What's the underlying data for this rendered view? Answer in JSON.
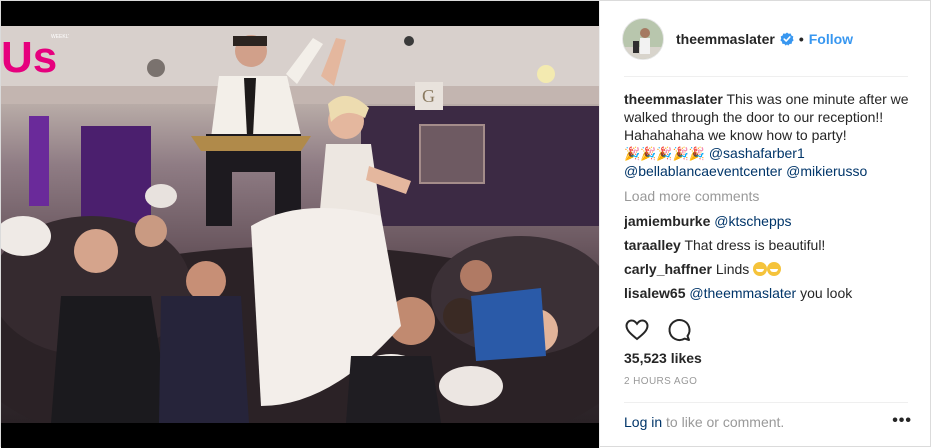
{
  "post": {
    "username": "theemmaslater",
    "verified": true,
    "follow_label": "Follow",
    "separator": "•",
    "caption": {
      "user": "theemmaslater",
      "text": "This was one minute after we walked through the door to our reception!! Hahahahaha we know how to party!",
      "emojis": "🎉🎉🎉🎉🎉",
      "mentions": [
        "@sashafarber1",
        "@bellablancaeventcenter",
        "@mikierusso"
      ]
    },
    "load_more_label": "Load more comments",
    "comments": [
      {
        "user": "jamiemburke",
        "text": "@ktschepps",
        "is_mention": true
      },
      {
        "user": "taraalley",
        "text": "That dress is beautiful!",
        "is_mention": false
      },
      {
        "user": "carly_haffner",
        "text": "Linds",
        "is_mention": false
      },
      {
        "user": "lisalew65",
        "text": "@theemmaslater",
        "tail": "you look",
        "is_mention": true
      }
    ],
    "likes_label": "35,523 likes",
    "timestamp": "2 HOURS AGO",
    "login_link": "Log in",
    "login_suffix": "to like or comment.",
    "more_label": "•••"
  },
  "media": {
    "watermark_text": "Us",
    "watermark_small": "WEEKLY"
  },
  "colors": {
    "link": "#3897f0",
    "mention": "#003569",
    "muted": "#999999",
    "watermark": "#e6007e"
  },
  "icons": [
    "verified-badge-icon",
    "heart-icon",
    "comment-icon",
    "more-options-icon"
  ]
}
